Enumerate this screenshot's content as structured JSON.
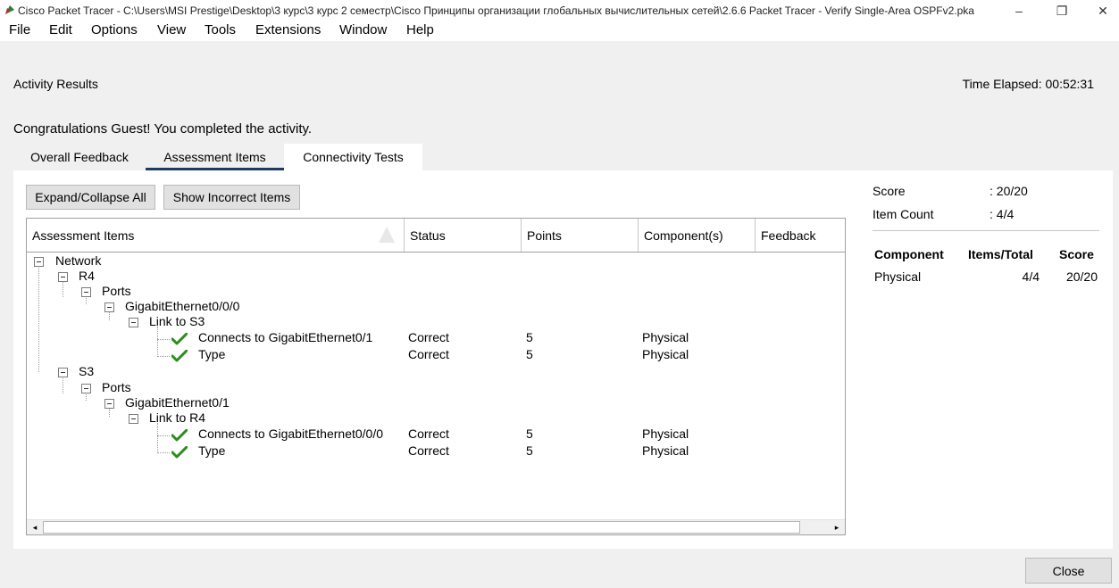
{
  "window": {
    "title": "Cisco Packet Tracer - C:\\Users\\MSI Prestige\\Desktop\\3 курс\\3 курс 2 семестр\\Cisco Принципы организации глобальных вычислительных сетей\\2.6.6 Packet Tracer - Verify Single-Area OSPFv2.pka",
    "minimize": "–",
    "restore": "❐",
    "close": "✕"
  },
  "menu": [
    "File",
    "Edit",
    "Options",
    "View",
    "Tools",
    "Extensions",
    "Window",
    "Help"
  ],
  "activity": {
    "title": "Activity Results",
    "time_elapsed": "Time Elapsed: 00:52:31",
    "congrats": "Congratulations Guest! You completed the activity."
  },
  "tabs": [
    "Overall Feedback",
    "Assessment Items",
    "Connectivity Tests"
  ],
  "active_tab": "Assessment Items",
  "toolbar": {
    "expand_collapse": "Expand/Collapse All",
    "show_incorrect": "Show Incorrect Items"
  },
  "grid": {
    "columns": [
      "Assessment Items",
      "Status",
      "Points",
      "Component(s)",
      "Feedback"
    ],
    "tree": [
      {
        "label": "Network",
        "depth": 0,
        "toggle": true
      },
      {
        "label": "R4",
        "depth": 1,
        "toggle": true
      },
      {
        "label": "Ports",
        "depth": 2,
        "toggle": true
      },
      {
        "label": "GigabitEthernet0/0/0",
        "depth": 3,
        "toggle": true
      },
      {
        "label": "Link to S3",
        "depth": 4,
        "toggle": true
      },
      {
        "label": "Connects to GigabitEthernet0/1",
        "depth": 5,
        "check": true,
        "status": "Correct",
        "points": "5",
        "component": "Physical"
      },
      {
        "label": "Type",
        "depth": 5,
        "check": true,
        "status": "Correct",
        "points": "5",
        "component": "Physical"
      },
      {
        "label": "S3",
        "depth": 1,
        "toggle": true
      },
      {
        "label": "Ports",
        "depth": 2,
        "toggle": true
      },
      {
        "label": "GigabitEthernet0/1",
        "depth": 3,
        "toggle": true
      },
      {
        "label": "Link to R4",
        "depth": 4,
        "toggle": true
      },
      {
        "label": "Connects to GigabitEthernet0/0/0",
        "depth": 5,
        "check": true,
        "status": "Correct",
        "points": "5",
        "component": "Physical"
      },
      {
        "label": "Type",
        "depth": 5,
        "check": true,
        "status": "Correct",
        "points": "5",
        "component": "Physical"
      }
    ]
  },
  "summary": {
    "score_label": "Score",
    "score_value": ": 20/20",
    "item_count_label": "Item Count",
    "item_count_value": ": 4/4",
    "table_headers": [
      "Component",
      "Items/Total",
      "Score"
    ],
    "table_rows": [
      {
        "component": "Physical",
        "items": "4/4",
        "score": "20/20"
      }
    ]
  },
  "footer": {
    "close": "Close"
  },
  "colors": {
    "check_green": "#2e8b1f",
    "tab_underline": "#1f3a66"
  }
}
